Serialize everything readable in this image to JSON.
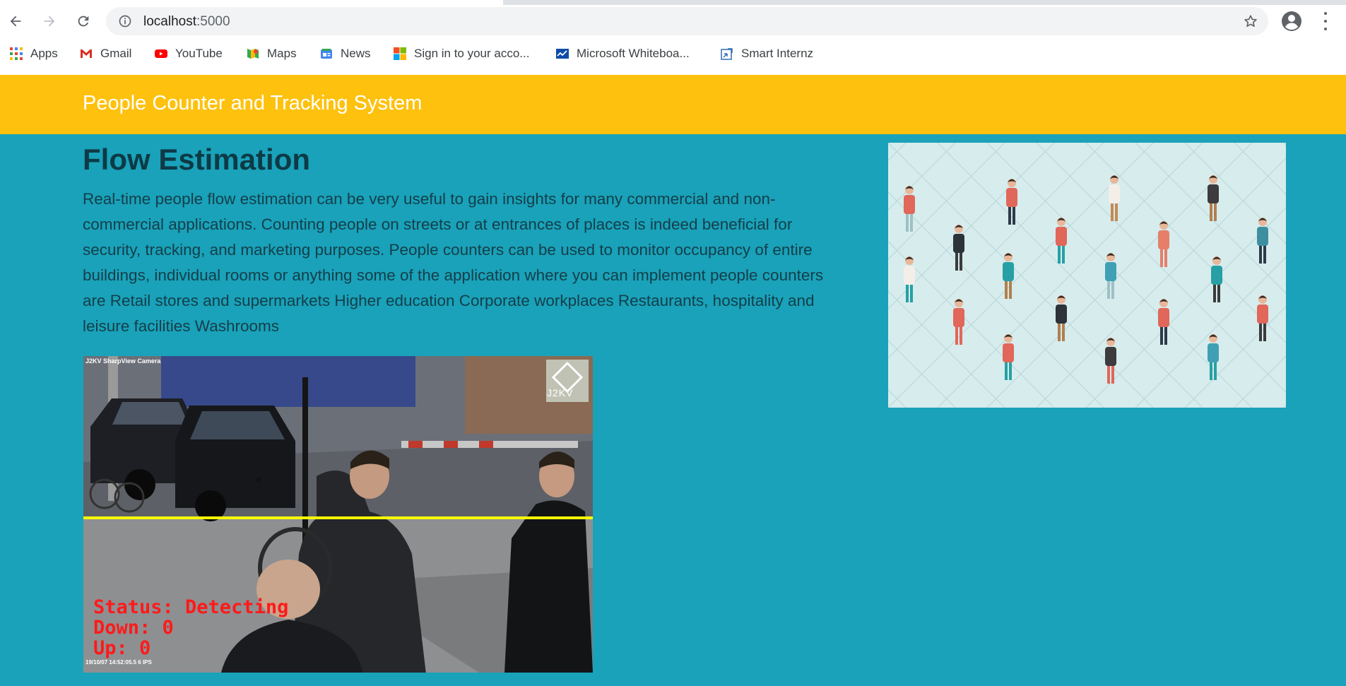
{
  "browser": {
    "url_host": "localhost",
    "url_port": ":5000",
    "bookmarks": [
      {
        "label": "Apps",
        "icon": "apps-grid-icon"
      },
      {
        "label": "Gmail",
        "icon": "gmail-icon"
      },
      {
        "label": "YouTube",
        "icon": "youtube-icon"
      },
      {
        "label": "Maps",
        "icon": "maps-icon"
      },
      {
        "label": "News",
        "icon": "news-icon"
      },
      {
        "label": "Sign in to your acco...",
        "icon": "microsoft-icon"
      },
      {
        "label": "Microsoft Whiteboa...",
        "icon": "whiteboard-icon"
      },
      {
        "label": "Smart Internz",
        "icon": "smartinternz-icon"
      }
    ]
  },
  "header": {
    "title": "People Counter and Tracking System",
    "color": "#fec10e"
  },
  "main": {
    "heading": "Flow Estimation",
    "paragraph": "Real-time people flow estimation can be very useful to gain insights for many commercial and non-commercial applications. Counting people on streets or at entrances of places is indeed beneficial for security, tracking, and marketing purposes. People counters can be used to monitor occupancy of entire buildings, individual rooms or anything some of the application where you can implement people counters are Retail stores and supermarkets Higher education Corporate workplaces Restaurants, hospitality and leisure facilities Washrooms",
    "background": "#19a2b9"
  },
  "video": {
    "camera_label": "J2KV SharpView Camera",
    "watermark": "J2KV",
    "status_line": "Status: Detecting",
    "down_line": "Down: 0",
    "up_line": "Up: 0",
    "timestamp": "19/10/07 14:52:05.5 6 IPS",
    "counting_line_color": "#ffff00",
    "overlay_text_color": "#ff1a1a"
  }
}
